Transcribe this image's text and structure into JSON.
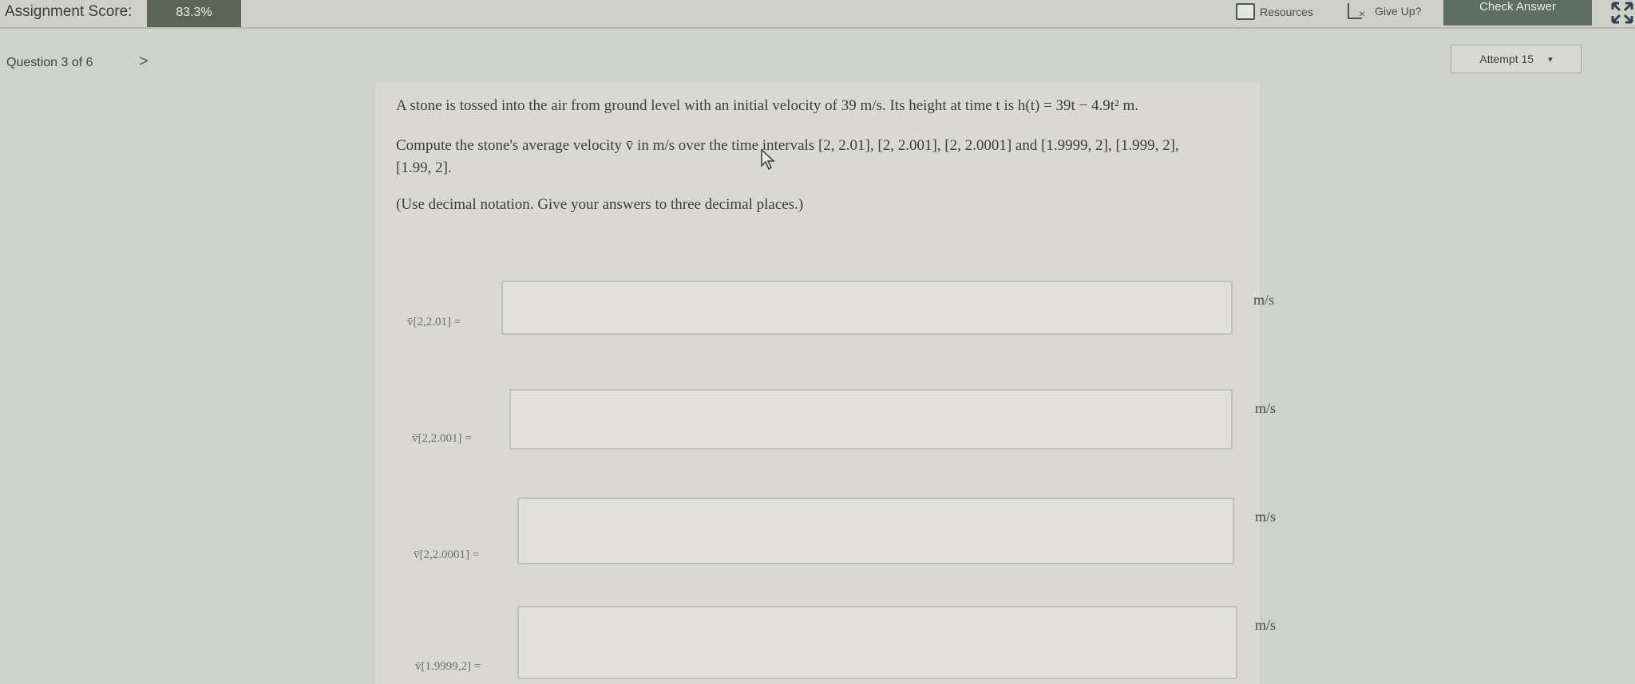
{
  "header": {
    "score_label": "Assignment Score:",
    "score_value": "83.3%",
    "resources_label": "Resources",
    "giveup_label": "Give Up?",
    "check_answer_label": "Check Answer",
    "resources_icon": "resources-icon",
    "giveup_icon": "give-up-icon",
    "expand_icon": "expand-icon"
  },
  "nav": {
    "question_label": "Question 3 of 6",
    "next_symbol": ">",
    "attempt_label": "Attempt 15",
    "attempt_caret": "▾"
  },
  "question": {
    "line1": "A stone is tossed into the air from ground level with an initial velocity of 39 m/s. Its height at time t is h(t) = 39t − 4.9t² m.",
    "line2": "Compute the stone's average velocity v̄ in m/s over the time intervals [2, 2.01], [2, 2.001], [2, 2.0001] and [1.9999, 2], [1.999, 2],",
    "line3": "[1.99, 2].",
    "instruction": "(Use decimal notation. Give your answers to three decimal places.)"
  },
  "answers": [
    {
      "label": "v̄[2,2.01] =",
      "value": "",
      "unit": "m/s"
    },
    {
      "label": "v̄[2,2.001] =",
      "value": "",
      "unit": "m/s"
    },
    {
      "label": "v̄[2,2.0001] =",
      "value": "",
      "unit": "m/s"
    },
    {
      "label": "v̄[1.9999,2] =",
      "value": "",
      "unit": "m/s"
    }
  ]
}
